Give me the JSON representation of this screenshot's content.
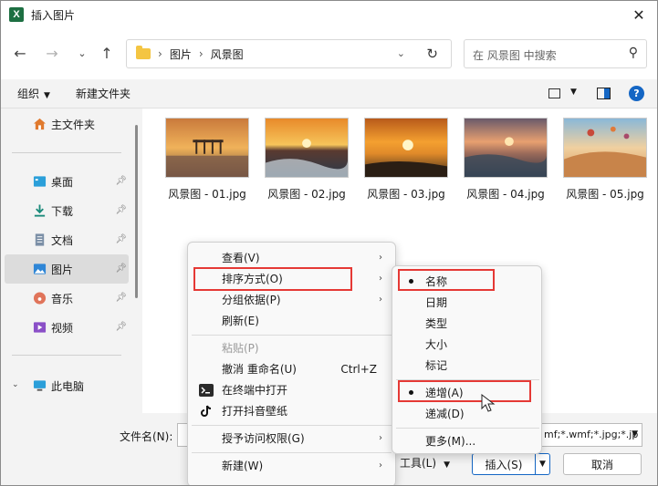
{
  "window": {
    "title": "插入图片",
    "app_icon_letter": "X"
  },
  "address": {
    "crumbs": [
      "图片",
      "风景图"
    ]
  },
  "search": {
    "placeholder": "在 风景图 中搜索"
  },
  "toolbar": {
    "organize": "组织",
    "new_folder": "新建文件夹",
    "help": "?"
  },
  "sidebar": {
    "items": [
      {
        "label": "主文件夹"
      },
      {
        "label": "桌面"
      },
      {
        "label": "下载"
      },
      {
        "label": "文档"
      },
      {
        "label": "图片"
      },
      {
        "label": "音乐"
      },
      {
        "label": "视频"
      },
      {
        "label": "此电脑"
      }
    ]
  },
  "files": [
    {
      "name": "风景图 - 01.jpg"
    },
    {
      "name": "风景图 - 02.jpg"
    },
    {
      "name": "风景图 - 03.jpg"
    },
    {
      "name": "风景图 - 04.jpg"
    },
    {
      "name": "风景图 - 05.jpg"
    }
  ],
  "bottom": {
    "filename_label": "文件名(N):",
    "filetype_value": "mf;*.wmf;*.jpg;*.jp",
    "tools_label": "工具(L)",
    "insert_label": "插入(S)",
    "cancel_label": "取消"
  },
  "context_menu": {
    "view": "查看(V)",
    "sort": "排序方式(O)",
    "group": "分组依据(P)",
    "refresh": "刷新(E)",
    "paste": "粘贴(P)",
    "undo": "撤消 重命名(U)",
    "undo_shortcut": "Ctrl+Z",
    "terminal": "在终端中打开",
    "tiktok": "打开抖音壁纸",
    "access": "授予访问权限(G)",
    "new": "新建(W)"
  },
  "sort_submenu": {
    "name": "名称",
    "date": "日期",
    "type": "类型",
    "size": "大小",
    "tags": "标记",
    "ascending": "递增(A)",
    "descending": "递减(D)",
    "more": "更多(M)..."
  },
  "colors": {
    "accent": "#1466c4",
    "highlight": "#e53935"
  }
}
